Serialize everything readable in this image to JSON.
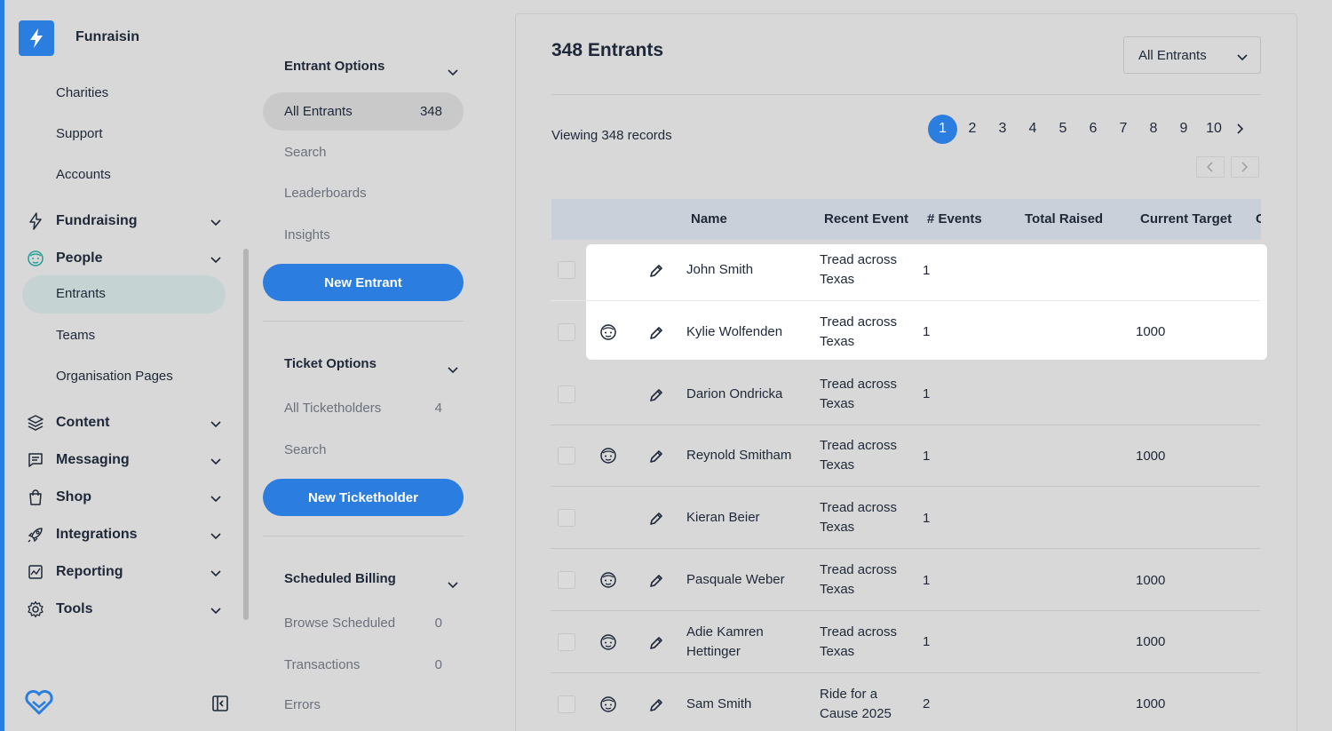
{
  "app": {
    "name": "Funraisin"
  },
  "sidebar": {
    "top_items": [
      "Charities",
      "Support",
      "Accounts"
    ],
    "sections": [
      {
        "label": "Fundraising",
        "icon": "lightning-icon"
      },
      {
        "label": "People",
        "icon": "face-icon"
      },
      {
        "label": "Content",
        "icon": "layers-icon"
      },
      {
        "label": "Messaging",
        "icon": "message-icon"
      },
      {
        "label": "Shop",
        "icon": "shopping-bag-icon"
      },
      {
        "label": "Integrations",
        "icon": "rocket-icon"
      },
      {
        "label": "Reporting",
        "icon": "chart-icon"
      },
      {
        "label": "Tools",
        "icon": "gear-icon"
      }
    ],
    "people_items": [
      "Entrants",
      "Teams",
      "Organisation Pages"
    ],
    "active_item": "Entrants"
  },
  "panel": {
    "entrant_options": {
      "title": "Entrant Options",
      "all_entrants_label": "All Entrants",
      "all_entrants_count": "348",
      "items": [
        "Search",
        "Leaderboards",
        "Insights"
      ],
      "button": "New Entrant"
    },
    "ticket_options": {
      "title": "Ticket Options",
      "all_label": "All Ticketholders",
      "all_count": "4",
      "search": "Search",
      "button": "New Ticketholder"
    },
    "scheduled_billing": {
      "title": "Scheduled Billing",
      "browse_label": "Browse Scheduled",
      "browse_count": "0",
      "transactions_label": "Transactions",
      "transactions_count": "0",
      "errors_label": "Errors"
    }
  },
  "main": {
    "title": "348 Entrants",
    "filter_value": "All Entrants",
    "records_text": "Viewing 348 records",
    "pages": [
      "1",
      "2",
      "3",
      "4",
      "5",
      "6",
      "7",
      "8",
      "9",
      "10"
    ],
    "current_page": "1",
    "columns": [
      "Name",
      "Recent Event",
      "# Events",
      "Total Raised",
      "Current Target",
      "C"
    ],
    "rows": [
      {
        "avatar": false,
        "name": "John Smith",
        "event": "Tread across Texas",
        "events": "1",
        "raised": "",
        "target": ""
      },
      {
        "avatar": true,
        "name": "Kylie Wolfenden",
        "event": "Tread across Texas",
        "events": "1",
        "raised": "",
        "target": "1000"
      },
      {
        "avatar": false,
        "name": "Darion Ondricka",
        "event": "Tread across Texas",
        "events": "1",
        "raised": "",
        "target": ""
      },
      {
        "avatar": true,
        "name": "Reynold Smitham",
        "event": "Tread across Texas",
        "events": "1",
        "raised": "",
        "target": "1000"
      },
      {
        "avatar": false,
        "name": "Kieran Beier",
        "event": "Tread across Texas",
        "events": "1",
        "raised": "",
        "target": ""
      },
      {
        "avatar": true,
        "name": "Pasquale Weber",
        "event": "Tread across Texas",
        "events": "1",
        "raised": "",
        "target": "1000"
      },
      {
        "avatar": true,
        "name": "Adie Kamren Hettinger",
        "event": "Tread across Texas",
        "events": "1",
        "raised": "",
        "target": "1000"
      },
      {
        "avatar": true,
        "name": "Sam Smith",
        "event": "Ride for a Cause 2025",
        "events": "2",
        "raised": "",
        "target": "1000"
      }
    ]
  },
  "colors": {
    "accent": "#2b7de0",
    "background": "#d8d8d8",
    "header": "#c9d0da",
    "active_nav": "#c6d3d3"
  }
}
